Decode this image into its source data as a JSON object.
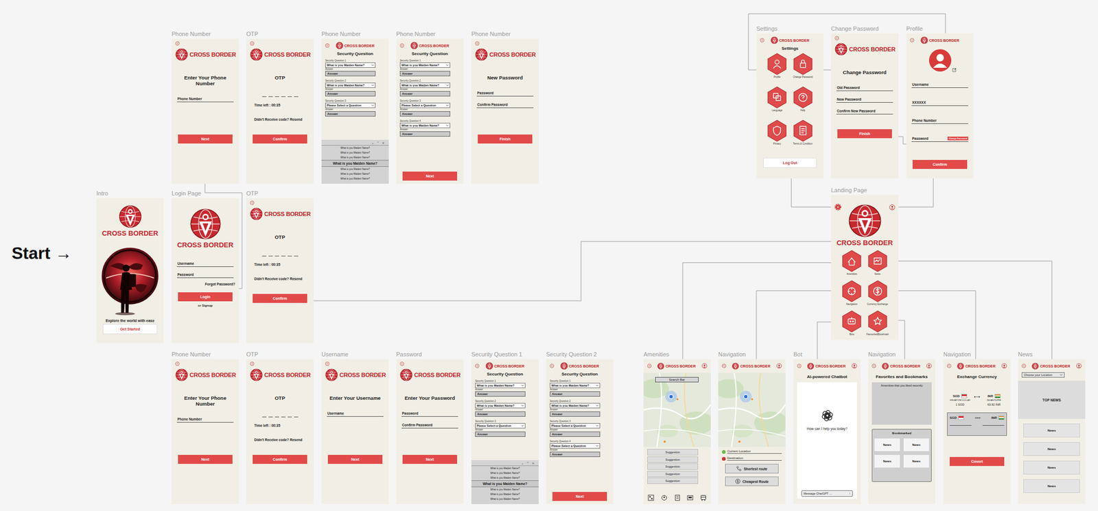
{
  "start": "Start →",
  "frames": [
    {
      "label": "Phone Number",
      "items": [
        {
          "kind": "header",
          "brand": "CROSS BORDER"
        },
        {
          "kind": "title",
          "text": "Enter Your Phone Number"
        },
        {
          "kind": "field",
          "label": "Phone Number"
        },
        {
          "kind": "button",
          "text": "Next"
        }
      ]
    },
    {
      "label": "OTP",
      "items": [
        {
          "kind": "header",
          "brand": "CROSS BORDER"
        },
        {
          "kind": "title",
          "text": "OTP"
        },
        {
          "kind": "otp"
        },
        {
          "kind": "note",
          "text": "Time left : 00:35"
        },
        {
          "kind": "note",
          "text": "Didn't Receive code? Resend"
        },
        {
          "kind": "button",
          "text": "Confirm"
        }
      ]
    },
    {
      "label": "Phone Number",
      "items": [
        {
          "kind": "header-small",
          "brand": "CROSS BORDER"
        },
        {
          "kind": "title",
          "text": "Security Question"
        },
        {
          "kind": "question",
          "label": "Security Question 1",
          "select": "What is you Maiden Name?",
          "answer_label": "Answer",
          "answer": "Answer"
        },
        {
          "kind": "question",
          "label": "Security Question 2",
          "select": "What is you Maiden Name?",
          "answer_label": "Answer",
          "answer": "Answer"
        },
        {
          "kind": "question",
          "label": "Security Question 3",
          "select": "Please Select a Question",
          "answer_label": "Answer",
          "answer": "Answer"
        },
        {
          "kind": "picker",
          "controls": [
            "⌄",
            "⌃",
            "×"
          ],
          "options": [
            {
              "text": "What is you Maiden Name?",
              "selected": false
            },
            {
              "text": "What is you Maiden Name?",
              "selected": false
            },
            {
              "text": "What is you Maiden Name?",
              "selected": false
            },
            {
              "text": "What is you Maiden Name?",
              "selected": true
            },
            {
              "text": "What is you Maiden Name?",
              "selected": false
            },
            {
              "text": "What is you Maiden Name?",
              "selected": false
            },
            {
              "text": "What is you Maiden Name?",
              "selected": false
            }
          ]
        }
      ]
    },
    {
      "label": "Phone Number",
      "items": [
        {
          "kind": "header-small",
          "brand": "CROSS BORDER"
        },
        {
          "kind": "title",
          "text": "Security Question"
        },
        {
          "kind": "question",
          "label": "Security Question 1",
          "select": "What is you Maiden Name?",
          "answer_label": "Answer",
          "answer": "Answer"
        },
        {
          "kind": "question",
          "label": "Security Question 2",
          "select": "What is you Maiden Name?",
          "answer_label": "Answer",
          "answer": "Answer"
        },
        {
          "kind": "question",
          "label": "Security Question 3",
          "select": "Please Select a Question",
          "answer_label": "Answer",
          "answer": "Answer"
        },
        {
          "kind": "question",
          "label": "Security Question 4",
          "select": "What is you Maiden Name?",
          "answer_label": "Answer",
          "answer": "Answer"
        },
        {
          "kind": "button",
          "text": "Next"
        }
      ]
    },
    {
      "label": "Phone Number",
      "items": [
        {
          "kind": "header",
          "brand": "CROSS BORDER"
        },
        {
          "kind": "title",
          "text": "New Password"
        },
        {
          "kind": "field",
          "label": "Password"
        },
        {
          "kind": "field",
          "label": "Confirm Password"
        },
        {
          "kind": "button",
          "text": "Finish"
        }
      ]
    },
    {
      "label": "Intro",
      "items": [
        {
          "kind": "logo",
          "brand": "CROSS BORDER"
        },
        {
          "kind": "illustration"
        },
        {
          "kind": "tagline",
          "text": "Explore the world with ease"
        },
        {
          "kind": "button-light",
          "text": "Get Started"
        }
      ]
    },
    {
      "label": "Login Page",
      "items": [
        {
          "kind": "logo",
          "brand": "CROSS BORDER"
        },
        {
          "kind": "field",
          "label": "Username"
        },
        {
          "kind": "field",
          "label": "Password"
        },
        {
          "kind": "link",
          "text": "Forgot Password?"
        },
        {
          "kind": "button",
          "text": "Login"
        },
        {
          "kind": "note",
          "text": "or Signup"
        }
      ]
    },
    {
      "label": "OTP",
      "items": [
        {
          "kind": "header",
          "brand": "CROSS BORDER"
        },
        {
          "kind": "title",
          "text": "OTP"
        },
        {
          "kind": "otp"
        },
        {
          "kind": "note",
          "text": "Time left : 00:35"
        },
        {
          "kind": "note",
          "text": "Didn't Receive code? Resend"
        },
        {
          "kind": "button",
          "text": "Confirm"
        }
      ]
    },
    {
      "label": "Phone Number",
      "items": [
        {
          "kind": "header",
          "brand": "CROSS BORDER"
        },
        {
          "kind": "title",
          "text": "Enter Your Phone Number"
        },
        {
          "kind": "field",
          "label": "Phone Number"
        },
        {
          "kind": "button",
          "text": "Next"
        }
      ]
    },
    {
      "label": "OTP",
      "items": [
        {
          "kind": "header",
          "brand": "CROSS BORDER"
        },
        {
          "kind": "title",
          "text": "OTP"
        },
        {
          "kind": "otp"
        },
        {
          "kind": "note",
          "text": "Time left : 00:35"
        },
        {
          "kind": "note",
          "text": "Didn't Receive code? Resend"
        },
        {
          "kind": "button",
          "text": "Confirm"
        }
      ]
    },
    {
      "label": "Username",
      "items": [
        {
          "kind": "header",
          "brand": "CROSS BORDER"
        },
        {
          "kind": "title",
          "text": "Enter Your Username"
        },
        {
          "kind": "field",
          "label": "Username"
        },
        {
          "kind": "button",
          "text": "Next"
        }
      ]
    },
    {
      "label": "Password",
      "items": [
        {
          "kind": "header",
          "brand": "CROSS BORDER"
        },
        {
          "kind": "title",
          "text": "Enter Your Password"
        },
        {
          "kind": "field",
          "label": "Password"
        },
        {
          "kind": "field",
          "label": "Confirm Password"
        },
        {
          "kind": "button",
          "text": "Next"
        }
      ]
    },
    {
      "label": "Security Question 1",
      "items": [
        {
          "kind": "header-small",
          "brand": "CROSS BORDER"
        },
        {
          "kind": "title",
          "text": "Security Question"
        },
        {
          "kind": "question",
          "label": "Security Question 1",
          "select": "What is you Maiden Name?",
          "answer_label": "Answer",
          "answer": "Answer"
        },
        {
          "kind": "question",
          "label": "Security Question 2",
          "select": "What is you Maiden Name?",
          "answer_label": "Answer",
          "answer": "Answer"
        },
        {
          "kind": "question",
          "label": "Security Question 3",
          "select": "Please Select a Question",
          "answer_label": "Answer",
          "answer": "Answer"
        },
        {
          "kind": "picker",
          "controls": [
            "⌄",
            "⌃",
            "×"
          ],
          "options": [
            {
              "text": "What is you Maiden Name?",
              "selected": false
            },
            {
              "text": "What is you Maiden Name?",
              "selected": false
            },
            {
              "text": "What is you Maiden Name?",
              "selected": false
            },
            {
              "text": "What is you Maiden Name?",
              "selected": true
            },
            {
              "text": "What is you Maiden Name?",
              "selected": false
            },
            {
              "text": "What is you Maiden Name?",
              "selected": false
            },
            {
              "text": "What is you Maiden Name?",
              "selected": false
            }
          ]
        }
      ]
    },
    {
      "label": "Security Question 2",
      "items": [
        {
          "kind": "header-small",
          "brand": "CROSS BORDER"
        },
        {
          "kind": "title",
          "text": "Security Question"
        },
        {
          "kind": "question",
          "label": "Security Question 1",
          "select": "What is you Maiden Name?",
          "answer_label": "Answer",
          "answer": "Answer"
        },
        {
          "kind": "question",
          "label": "Security Question 2",
          "select": "What is you Maiden Name?",
          "answer_label": "Answer",
          "answer": "Answer"
        },
        {
          "kind": "question",
          "label": "Security Question 3",
          "select": "Please Select a Question",
          "answer_label": "Answer",
          "answer": "Answer"
        },
        {
          "kind": "question",
          "label": "Security Question 4",
          "select": "Please Select a Question",
          "answer_label": "Answer",
          "answer": "Answer"
        },
        {
          "kind": "button",
          "text": "Next"
        }
      ]
    },
    {
      "label": "Amenities",
      "items": [
        {
          "kind": "header-app",
          "brand": "CROSS BORDER"
        },
        {
          "kind": "map",
          "search": "Search Bar"
        },
        {
          "kind": "list",
          "items": [
            "Suggestion",
            "Suggestion",
            "Suggestion",
            "Suggestion",
            "Suggestion"
          ]
        },
        {
          "kind": "iconbar"
        }
      ]
    },
    {
      "label": "Navigation",
      "items": [
        {
          "kind": "header-app",
          "brand": "CROSS BORDER"
        },
        {
          "kind": "map"
        },
        {
          "kind": "route",
          "items": [
            {
              "text": "Current Location",
              "color": "#6dbb4a"
            },
            {
              "text": "Destination",
              "color": "#d32f2f"
            }
          ]
        },
        {
          "kind": "route-button",
          "text": "Shortest route"
        },
        {
          "kind": "route-button",
          "text": "Cheapest Route"
        }
      ]
    },
    {
      "label": "Bot",
      "items": [
        {
          "kind": "header-app",
          "brand": "CROSS BORDER"
        },
        {
          "kind": "title",
          "text": "AI-powered Chatbot"
        },
        {
          "kind": "chat",
          "prompt": "How can I help you today?",
          "placeholder": "Message ChatGPT ....",
          "send": "↑"
        }
      ]
    },
    {
      "label": "Navigation",
      "items": [
        {
          "kind": "header-app",
          "brand": "CROSS BORDER"
        },
        {
          "kind": "title",
          "text": "Favorites and Bookmarks"
        },
        {
          "kind": "panel",
          "text": "Amenities that you liked recently"
        },
        {
          "kind": "bookmarks",
          "title": "Bookmarked",
          "items": [
            "News",
            "News",
            "News",
            "News"
          ]
        }
      ]
    },
    {
      "label": "Navigation",
      "items": [
        {
          "kind": "header-app",
          "brand": "CROSS BORDER"
        },
        {
          "kind": "title",
          "text": "Exchange Currency"
        },
        {
          "kind": "rate",
          "from": "SGD",
          "to": "INR",
          "swap": "⟷",
          "from_name": "SINGAPORE DOLLAR",
          "to_name": "INDIAN RUPEE",
          "from_amount": "1 SGD",
          "to_amount": "63.92 INR"
        },
        {
          "kind": "converter",
          "from": "SGD",
          "arrows": ">>>",
          "to": "INR"
        },
        {
          "kind": "button",
          "text": "Covert"
        }
      ]
    },
    {
      "label": "News",
      "items": [
        {
          "kind": "header-app",
          "brand": "CROSS BORDER"
        },
        {
          "kind": "select",
          "text": "Choose your Location"
        },
        {
          "kind": "banner",
          "text": "TOP NEWS"
        },
        {
          "kind": "news",
          "items": [
            "News",
            "News",
            "News",
            "News"
          ]
        }
      ]
    },
    {
      "label": "Settings",
      "items": [
        {
          "kind": "header-small",
          "brand": "CROSS BORDER"
        },
        {
          "kind": "title",
          "text": "Settings"
        },
        {
          "kind": "hexgrid",
          "items": [
            "Profile",
            "Change Password",
            "Language",
            "Help",
            "Privacy",
            "Terms & Condition"
          ]
        },
        {
          "kind": "button-light",
          "text": "Log Out"
        }
      ]
    },
    {
      "label": "Change Password",
      "items": [
        {
          "kind": "header",
          "brand": "CROSS BORDER"
        },
        {
          "kind": "title",
          "text": "Change Password"
        },
        {
          "kind": "field",
          "label": "Old Password"
        },
        {
          "kind": "field",
          "label": "New Password"
        },
        {
          "kind": "field",
          "label": "Confirm New Password"
        },
        {
          "kind": "button",
          "text": "Finish"
        }
      ]
    },
    {
      "label": "Profile",
      "items": [
        {
          "kind": "header-small",
          "brand": "CROSS BORDER"
        },
        {
          "kind": "avatar"
        },
        {
          "kind": "field",
          "label": "Username"
        },
        {
          "kind": "field",
          "label": "XXXXXX"
        },
        {
          "kind": "field",
          "label": "Phone Number"
        },
        {
          "kind": "field-badge",
          "label": "Password",
          "badge": "Change Password"
        },
        {
          "kind": "button",
          "text": "Confirm"
        }
      ]
    },
    {
      "label": "Landing Page",
      "items": [
        {
          "kind": "landing-top"
        },
        {
          "kind": "logo",
          "brand": "CROSS BORDER"
        },
        {
          "kind": "hexgrid",
          "items": [
            "Amenities",
            "News",
            "Navigation",
            "Currency Exchange",
            "Bots",
            "Favourite&Bookmark"
          ]
        }
      ]
    }
  ]
}
